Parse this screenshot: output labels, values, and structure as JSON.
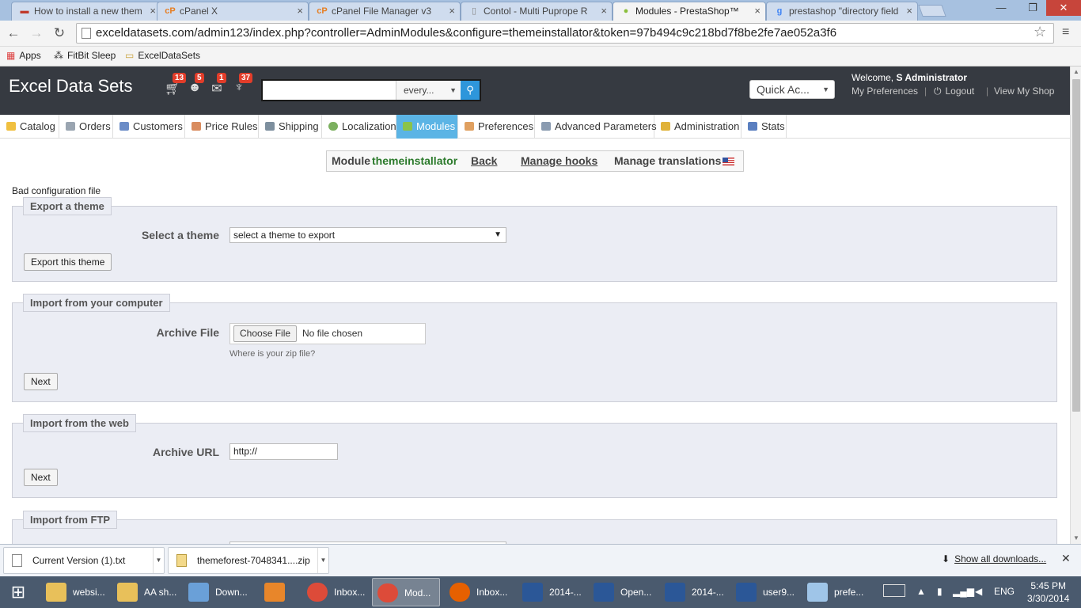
{
  "browser": {
    "tabs": [
      {
        "title": "How to install a new them",
        "favicon": "flag-icon",
        "color": "#c0392b"
      },
      {
        "title": "cPanel X",
        "favicon": "cpanel-icon",
        "color": "#e67e22"
      },
      {
        "title": "cPanel File Manager v3",
        "favicon": "cpanel-icon",
        "color": "#e67e22"
      },
      {
        "title": "Contol - Multi Puprope R",
        "favicon": "page-icon",
        "color": "#888888"
      },
      {
        "title": "Modules - PrestaShop™",
        "favicon": "prestashop-icon",
        "color": "#8bbf3b"
      },
      {
        "title": "prestashop \"directory field",
        "favicon": "google-icon",
        "color": "#4285f4"
      }
    ],
    "address": "exceldatasets.com/admin123/index.php?controller=AdminModules&configure=themeinstallator&token=97b494c9c218bd7f8be2fe7ae052a3f6",
    "bookmarks": [
      {
        "label": "Apps",
        "icon": "apps-grid-icon"
      },
      {
        "label": "FitBit Sleep",
        "icon": "fitbit-icon"
      },
      {
        "label": "ExcelDataSets",
        "icon": "folder-icon"
      }
    ]
  },
  "header": {
    "shop_name": "Excel Data Sets",
    "notifications": [
      {
        "icon": "cart-icon",
        "count": "13"
      },
      {
        "icon": "customer-icon",
        "count": "5"
      },
      {
        "icon": "message-icon",
        "count": "1"
      },
      {
        "icon": "trophy-icon",
        "count": "37"
      }
    ],
    "search_value": "",
    "search_scope": "every...",
    "quick_access": "Quick Ac...",
    "welcome_prefix": "Welcome,",
    "welcome_name": "S Administrator",
    "my_preferences": "My Preferences",
    "logout": "Logout",
    "view_shop": "View My Shop"
  },
  "menu": [
    {
      "label": "Catalog",
      "color": "#f0c040"
    },
    {
      "label": "Orders",
      "color": "#9aa5b1"
    },
    {
      "label": "Customers",
      "color": "#6b8cc7"
    },
    {
      "label": "Price Rules",
      "color": "#d98c5f"
    },
    {
      "label": "Shipping",
      "color": "#7d8f9e"
    },
    {
      "label": "Localization",
      "color": "#7cb05f"
    },
    {
      "label": "Modules",
      "color": "#8bc34a"
    },
    {
      "label": "Preferences",
      "color": "#e0a060"
    },
    {
      "label": "Advanced Parameters",
      "color": "#8a9bb0"
    },
    {
      "label": "Administration",
      "color": "#e0b23a"
    },
    {
      "label": "Stats",
      "color": "#5a7fc0"
    }
  ],
  "module_toolbar": {
    "module_label": "Module",
    "module_name": "themeinstallator",
    "back": "Back",
    "manage_hooks": "Manage hooks",
    "manage_translations": "Manage translations"
  },
  "error": "Bad configuration file",
  "export": {
    "legend": "Export a theme",
    "select_label": "Select a theme",
    "select_value": "select a theme to export",
    "button": "Export this theme"
  },
  "import_computer": {
    "legend": "Import from your computer",
    "label": "Archive File",
    "choose_file": "Choose File",
    "file_status": "No file chosen",
    "hint": "Where is your zip file?",
    "button": "Next"
  },
  "import_web": {
    "legend": "Import from the web",
    "label": "Archive URL",
    "url_value": "http://",
    "button": "Next"
  },
  "import_ftp": {
    "legend": "Import from FTP"
  },
  "downloads": {
    "items": [
      {
        "name": "Current Version (1).txt"
      },
      {
        "name": "themeforest-7048341....zip"
      }
    ],
    "show_all": "Show all downloads..."
  },
  "taskbar": {
    "items": [
      {
        "label": "websi...",
        "icon": "folder-icon",
        "color": "#e8c05a"
      },
      {
        "label": "AA sh...",
        "icon": "folder-icon",
        "color": "#e8c05a"
      },
      {
        "label": "Down...",
        "icon": "downloads-folder-icon",
        "color": "#6aa0d8"
      },
      {
        "label": "",
        "icon": "media-player-icon",
        "color": "#e8862a"
      },
      {
        "label": "Inbox...",
        "icon": "chrome-icon",
        "color": "#dd4b39"
      },
      {
        "label": "Mod...",
        "icon": "chrome-icon",
        "color": "#dd4b39"
      },
      {
        "label": "Inbox...",
        "icon": "firefox-icon",
        "color": "#e66000"
      },
      {
        "label": "2014-...",
        "icon": "word-icon",
        "color": "#2b5797"
      },
      {
        "label": "Open...",
        "icon": "word-icon",
        "color": "#2b5797"
      },
      {
        "label": "2014-...",
        "icon": "word-icon",
        "color": "#2b5797"
      },
      {
        "label": "user9...",
        "icon": "word-icon",
        "color": "#2b5797"
      },
      {
        "label": "prefe...",
        "icon": "paint-icon",
        "color": "#9fc5e8"
      }
    ],
    "language": "ENG",
    "time": "5:45 PM",
    "date": "3/30/2014"
  }
}
